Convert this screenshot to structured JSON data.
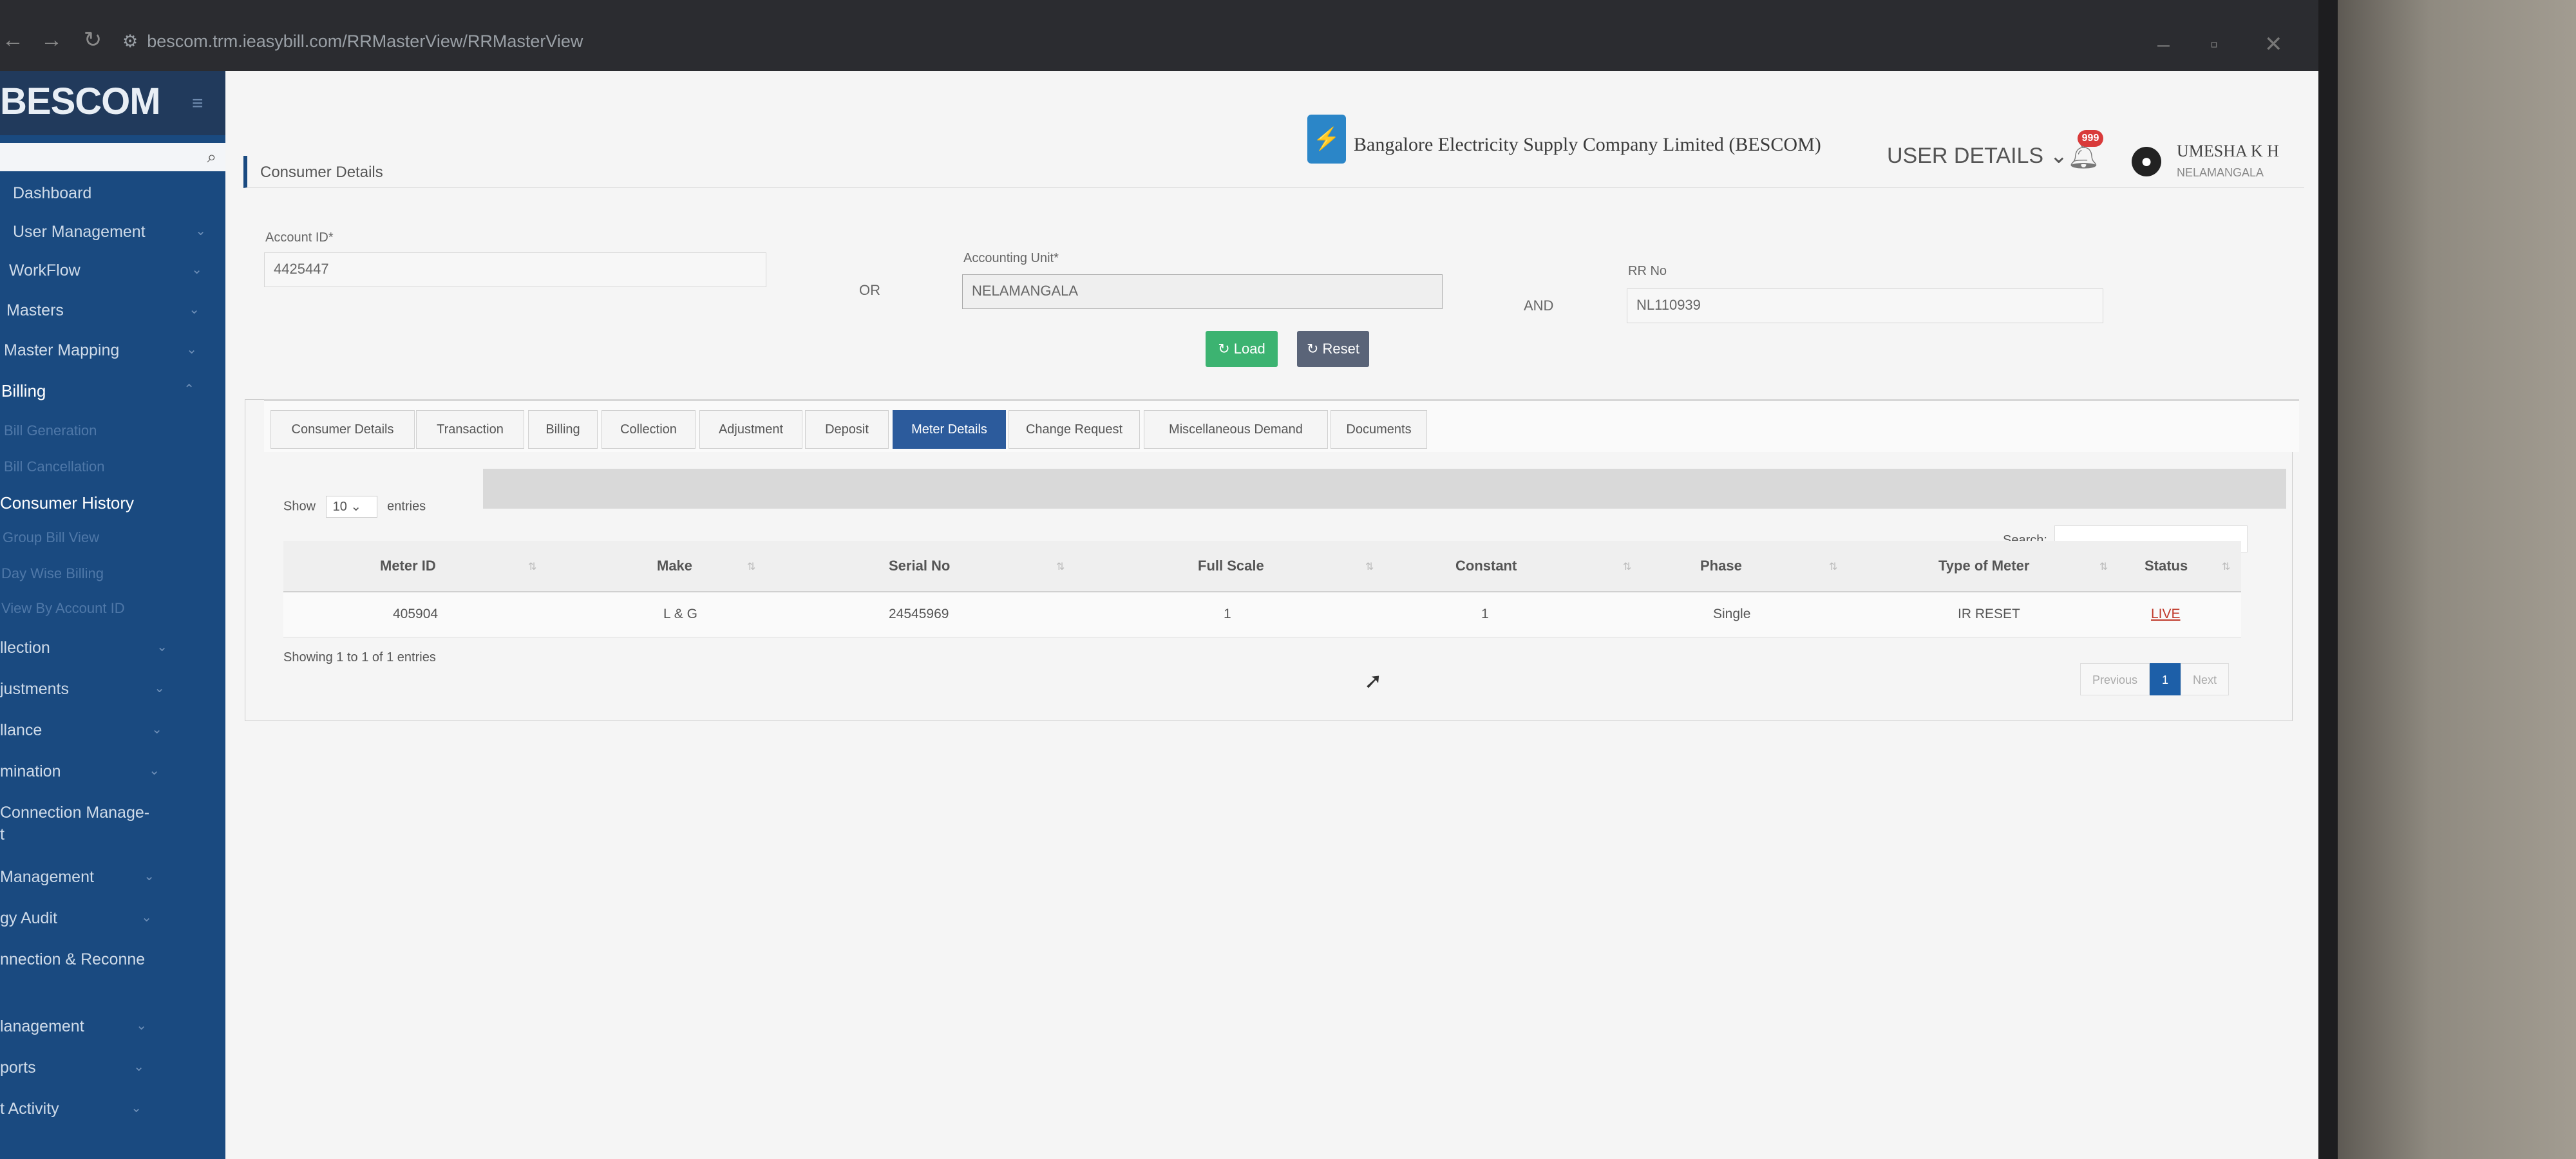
{
  "browser": {
    "url": "bescom.trm.ieasybill.com/RRMasterView/RRMasterView"
  },
  "sidebar": {
    "brand": "BESCOM",
    "items": [
      {
        "label": "Dashboard"
      },
      {
        "label": "User Management"
      },
      {
        "label": "WorkFlow"
      },
      {
        "label": "Masters"
      },
      {
        "label": "Master Mapping"
      },
      {
        "label": "Billing"
      },
      {
        "label": "Bill Generation"
      },
      {
        "label": "Bill Cancellation"
      },
      {
        "label": "Consumer History"
      },
      {
        "label": "Group Bill View"
      },
      {
        "label": "Day Wise Billing"
      },
      {
        "label": "View By Account ID"
      },
      {
        "label": "llection"
      },
      {
        "label": "justments"
      },
      {
        "label": "llance"
      },
      {
        "label": "mination"
      },
      {
        "label": "Connection Manage-"
      },
      {
        "label": "t"
      },
      {
        "label": "Management"
      },
      {
        "label": "gy Audit"
      },
      {
        "label": "nnection & Reconne"
      },
      {
        "label": "lanagement"
      },
      {
        "label": "ports"
      },
      {
        "label": "t Activity"
      }
    ]
  },
  "header": {
    "company": "Bangalore Electricity Supply Company Limited (BESCOM)",
    "user_details": "USER DETAILS",
    "notification_badge": "999",
    "user_name": "UMESHA K H",
    "user_unit": "NELAMANGALA"
  },
  "breadcrumb": "Consumer Details",
  "form": {
    "account_id_label": "Account ID*",
    "account_id_value": "4425447",
    "or_label": "OR",
    "accounting_unit_label": "Accounting Unit*",
    "accounting_unit_value": "NELAMANGALA",
    "and_label": "AND",
    "rr_no_label": "RR No",
    "rr_no_value": "NL110939",
    "load_label": "Load",
    "reset_label": "Reset"
  },
  "tabs": [
    {
      "label": "Consumer Details"
    },
    {
      "label": "Transaction"
    },
    {
      "label": "Billing"
    },
    {
      "label": "Collection"
    },
    {
      "label": "Adjustment"
    },
    {
      "label": "Deposit"
    },
    {
      "label": "Meter Details"
    },
    {
      "label": "Change Request"
    },
    {
      "label": "Miscellaneous Demand"
    },
    {
      "label": "Documents"
    }
  ],
  "table": {
    "show_label": "Show",
    "entries_value": "10",
    "entries_label": "entries",
    "search_label": "Search:",
    "columns": [
      "Meter ID",
      "Make",
      "Serial No",
      "Full Scale",
      "Constant",
      "Phase",
      "Type of Meter",
      "Status"
    ],
    "rows": [
      [
        "405904",
        "L & G",
        "24545969",
        "1",
        "1",
        "Single",
        "IR RESET",
        "LIVE"
      ]
    ],
    "showing": "Showing 1 to 1 of 1 entries",
    "pager": {
      "previous": "Previous",
      "page": "1",
      "next": "Next"
    }
  },
  "colors": {
    "sidebar": "#1a4a80",
    "active_tab": "#2c5b9c",
    "load_button": "#3cb371",
    "reset_button": "#5a6478",
    "status_live": "#c0392b"
  }
}
